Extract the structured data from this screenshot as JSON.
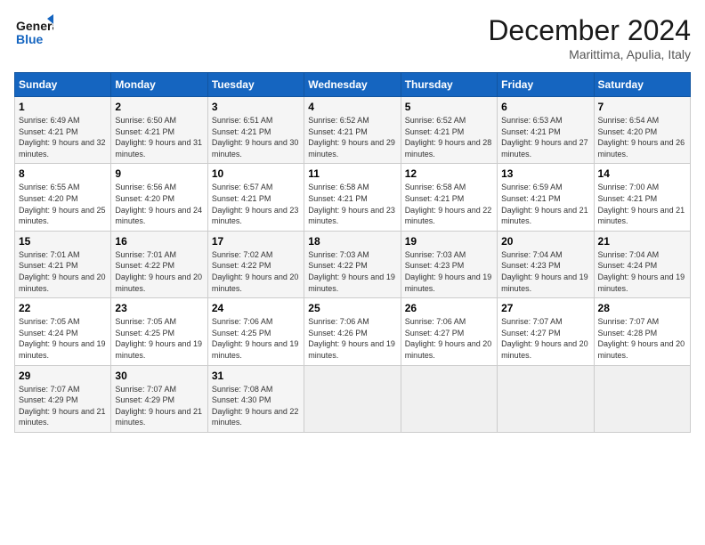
{
  "header": {
    "logo_line1": "General",
    "logo_line2": "Blue",
    "month_title": "December 2024",
    "location": "Marittima, Apulia, Italy"
  },
  "weekdays": [
    "Sunday",
    "Monday",
    "Tuesday",
    "Wednesday",
    "Thursday",
    "Friday",
    "Saturday"
  ],
  "days": [
    {
      "num": "",
      "info": ""
    },
    {
      "num": "",
      "info": ""
    },
    {
      "num": "",
      "info": ""
    },
    {
      "num": "",
      "info": ""
    },
    {
      "num": "",
      "info": ""
    },
    {
      "num": "",
      "info": ""
    },
    {
      "num": "",
      "info": ""
    },
    {
      "num": "1",
      "info": "Sunrise: 6:49 AM\nSunset: 4:21 PM\nDaylight: 9 hours and 32 minutes."
    },
    {
      "num": "2",
      "info": "Sunrise: 6:50 AM\nSunset: 4:21 PM\nDaylight: 9 hours and 31 minutes."
    },
    {
      "num": "3",
      "info": "Sunrise: 6:51 AM\nSunset: 4:21 PM\nDaylight: 9 hours and 30 minutes."
    },
    {
      "num": "4",
      "info": "Sunrise: 6:52 AM\nSunset: 4:21 PM\nDaylight: 9 hours and 29 minutes."
    },
    {
      "num": "5",
      "info": "Sunrise: 6:52 AM\nSunset: 4:21 PM\nDaylight: 9 hours and 28 minutes."
    },
    {
      "num": "6",
      "info": "Sunrise: 6:53 AM\nSunset: 4:21 PM\nDaylight: 9 hours and 27 minutes."
    },
    {
      "num": "7",
      "info": "Sunrise: 6:54 AM\nSunset: 4:20 PM\nDaylight: 9 hours and 26 minutes."
    },
    {
      "num": "8",
      "info": "Sunrise: 6:55 AM\nSunset: 4:20 PM\nDaylight: 9 hours and 25 minutes."
    },
    {
      "num": "9",
      "info": "Sunrise: 6:56 AM\nSunset: 4:20 PM\nDaylight: 9 hours and 24 minutes."
    },
    {
      "num": "10",
      "info": "Sunrise: 6:57 AM\nSunset: 4:21 PM\nDaylight: 9 hours and 23 minutes."
    },
    {
      "num": "11",
      "info": "Sunrise: 6:58 AM\nSunset: 4:21 PM\nDaylight: 9 hours and 23 minutes."
    },
    {
      "num": "12",
      "info": "Sunrise: 6:58 AM\nSunset: 4:21 PM\nDaylight: 9 hours and 22 minutes."
    },
    {
      "num": "13",
      "info": "Sunrise: 6:59 AM\nSunset: 4:21 PM\nDaylight: 9 hours and 21 minutes."
    },
    {
      "num": "14",
      "info": "Sunrise: 7:00 AM\nSunset: 4:21 PM\nDaylight: 9 hours and 21 minutes."
    },
    {
      "num": "15",
      "info": "Sunrise: 7:01 AM\nSunset: 4:21 PM\nDaylight: 9 hours and 20 minutes."
    },
    {
      "num": "16",
      "info": "Sunrise: 7:01 AM\nSunset: 4:22 PM\nDaylight: 9 hours and 20 minutes."
    },
    {
      "num": "17",
      "info": "Sunrise: 7:02 AM\nSunset: 4:22 PM\nDaylight: 9 hours and 20 minutes."
    },
    {
      "num": "18",
      "info": "Sunrise: 7:03 AM\nSunset: 4:22 PM\nDaylight: 9 hours and 19 minutes."
    },
    {
      "num": "19",
      "info": "Sunrise: 7:03 AM\nSunset: 4:23 PM\nDaylight: 9 hours and 19 minutes."
    },
    {
      "num": "20",
      "info": "Sunrise: 7:04 AM\nSunset: 4:23 PM\nDaylight: 9 hours and 19 minutes."
    },
    {
      "num": "21",
      "info": "Sunrise: 7:04 AM\nSunset: 4:24 PM\nDaylight: 9 hours and 19 minutes."
    },
    {
      "num": "22",
      "info": "Sunrise: 7:05 AM\nSunset: 4:24 PM\nDaylight: 9 hours and 19 minutes."
    },
    {
      "num": "23",
      "info": "Sunrise: 7:05 AM\nSunset: 4:25 PM\nDaylight: 9 hours and 19 minutes."
    },
    {
      "num": "24",
      "info": "Sunrise: 7:06 AM\nSunset: 4:25 PM\nDaylight: 9 hours and 19 minutes."
    },
    {
      "num": "25",
      "info": "Sunrise: 7:06 AM\nSunset: 4:26 PM\nDaylight: 9 hours and 19 minutes."
    },
    {
      "num": "26",
      "info": "Sunrise: 7:06 AM\nSunset: 4:27 PM\nDaylight: 9 hours and 20 minutes."
    },
    {
      "num": "27",
      "info": "Sunrise: 7:07 AM\nSunset: 4:27 PM\nDaylight: 9 hours and 20 minutes."
    },
    {
      "num": "28",
      "info": "Sunrise: 7:07 AM\nSunset: 4:28 PM\nDaylight: 9 hours and 20 minutes."
    },
    {
      "num": "29",
      "info": "Sunrise: 7:07 AM\nSunset: 4:29 PM\nDaylight: 9 hours and 21 minutes."
    },
    {
      "num": "30",
      "info": "Sunrise: 7:07 AM\nSunset: 4:29 PM\nDaylight: 9 hours and 21 minutes."
    },
    {
      "num": "31",
      "info": "Sunrise: 7:08 AM\nSunset: 4:30 PM\nDaylight: 9 hours and 22 minutes."
    },
    {
      "num": "",
      "info": ""
    },
    {
      "num": "",
      "info": ""
    },
    {
      "num": "",
      "info": ""
    },
    {
      "num": "",
      "info": ""
    },
    {
      "num": "",
      "info": ""
    }
  ]
}
